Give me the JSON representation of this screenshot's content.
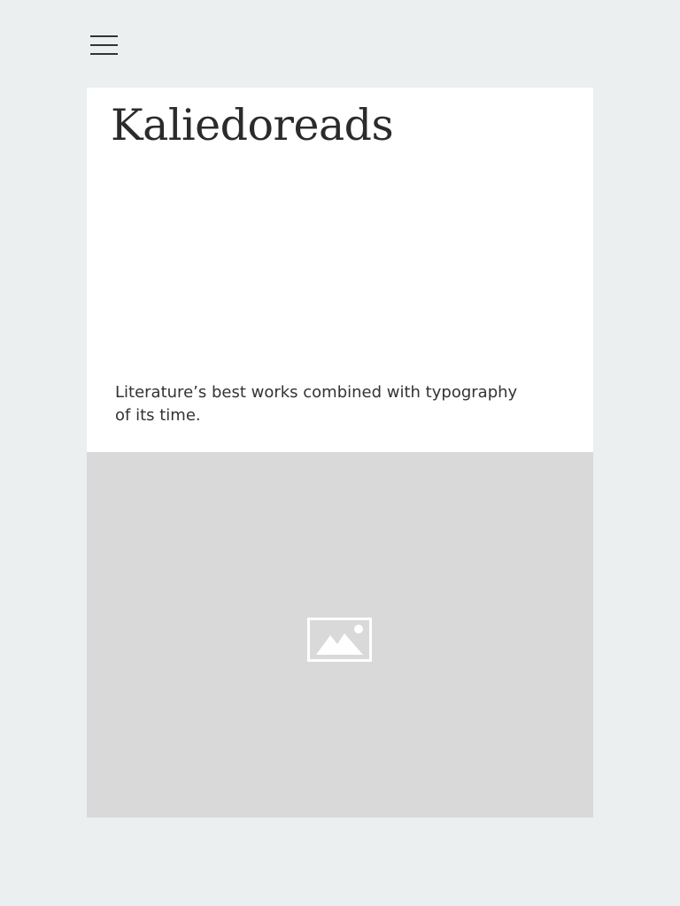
{
  "header": {
    "menu_icon": "hamburger-menu-icon"
  },
  "hero": {
    "title": "Kaliedoreads",
    "tagline": "Literature’s best works combined with typography of its time."
  },
  "media": {
    "placeholder_icon": "image-placeholder-icon",
    "placeholder_bg": "#d9d9d9"
  },
  "colors": {
    "page_bg": "#ebeff0",
    "card_bg": "#ffffff",
    "text": "#2b2b2b"
  }
}
